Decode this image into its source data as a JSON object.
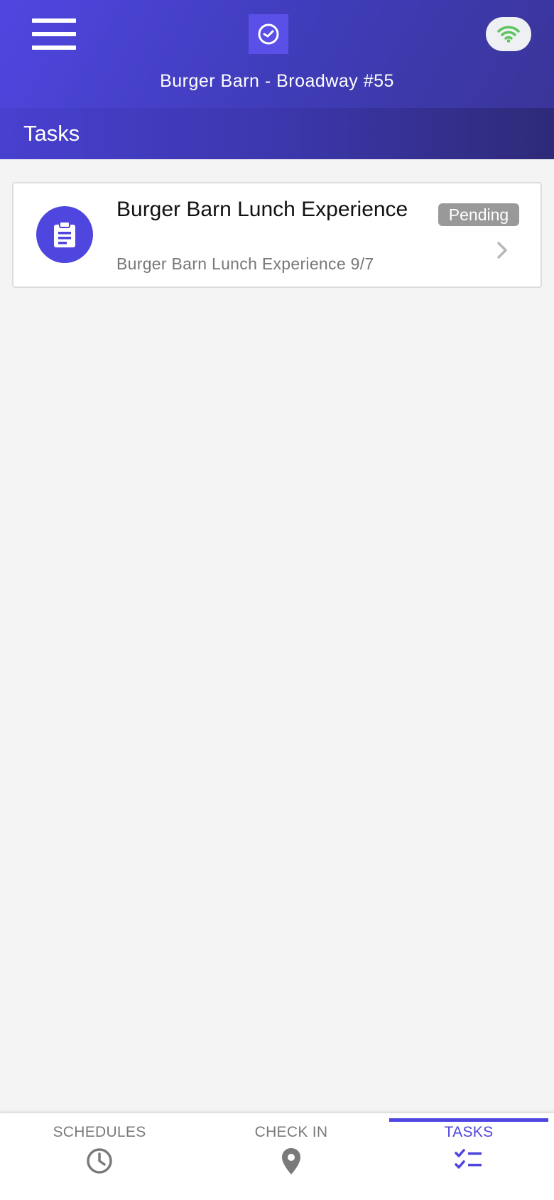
{
  "header": {
    "store_name": "Burger Barn - Broadway #55"
  },
  "page": {
    "title": "Tasks"
  },
  "tasks": [
    {
      "title": "Burger Barn Lunch Experience",
      "subtitle": "Burger Barn Lunch Experience 9/7",
      "status": "Pending",
      "icon": "clipboard-icon"
    }
  ],
  "nav": {
    "items": [
      {
        "label": "SCHEDULES",
        "icon": "clock-icon",
        "active": false
      },
      {
        "label": "CHECK IN",
        "icon": "map-pin-icon",
        "active": false
      },
      {
        "label": "TASKS",
        "icon": "checklist-icon",
        "active": true
      }
    ]
  },
  "colors": {
    "brand": "#4f46e0",
    "wifi_connected": "#5cc45c",
    "badge_pending": "#999999"
  }
}
